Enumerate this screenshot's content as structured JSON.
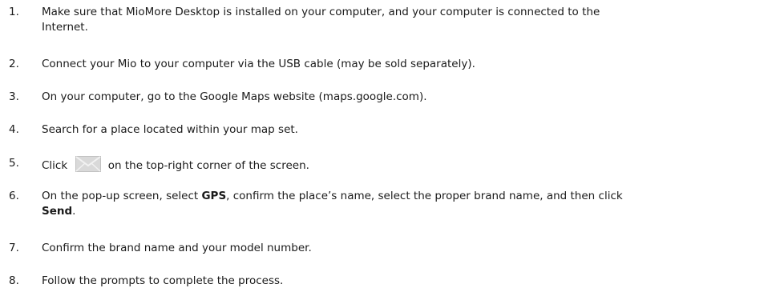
{
  "steps": [
    {
      "number": "1.",
      "line1": "Make sure that MioMore Desktop is installed on your computer, and your computer is connected to the",
      "line2": "Internet."
    },
    {
      "number": "2.",
      "text": "Connect your Mio to your computer via the USB cable (may be sold separately)."
    },
    {
      "number": "3.",
      "text": "On your computer, go to the Google Maps website (maps.google.com)."
    },
    {
      "number": "4.",
      "text": "Search for a place located within your map set."
    },
    {
      "number": "5.",
      "before": "Click",
      "icon": "mail-icon",
      "after": "on the top-right corner of the screen."
    },
    {
      "number": "6.",
      "part1": "On the pop-up screen, select ",
      "bold1": "GPS",
      "part2": ", confirm the place’s name, select the proper brand name, and then click",
      "bold2": "Send",
      "part3": "."
    },
    {
      "number": "7.",
      "text": "Confirm the brand name and your model number."
    },
    {
      "number": "8.",
      "text": "Follow the prompts to complete the process."
    }
  ],
  "colors": {
    "text": "#1a1a1a",
    "icon": "#c8c8c8"
  }
}
